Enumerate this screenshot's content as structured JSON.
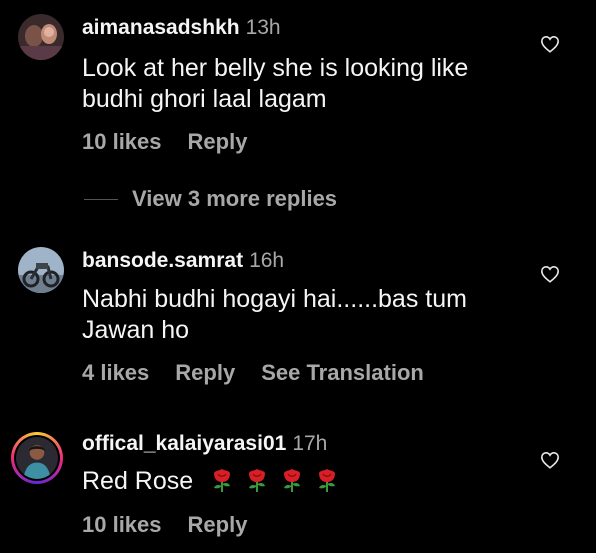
{
  "comments": [
    {
      "username": "aimanasadshkh",
      "time": "13h",
      "text": "Look at her belly she is looking like budhi ghori laal lagam",
      "likes": "10 likes",
      "reply": "Reply",
      "avatar_icon": "profile-photo"
    },
    {
      "username": "bansode.samrat",
      "time": "16h",
      "text": "Nabhi budhi hogayi hai......bas tum Jawan ho",
      "likes": "4 likes",
      "reply": "Reply",
      "translation": "See Translation",
      "avatar_icon": "motorcycle-photo"
    },
    {
      "username": "offical_kalaiyarasi01",
      "time": "17h",
      "text": "Red Rose",
      "emoji": [
        "rose-emoji",
        "rose-emoji",
        "rose-emoji",
        "rose-emoji"
      ],
      "likes": "10 likes",
      "reply": "Reply",
      "avatar_icon": "profile-photo-story-ring"
    }
  ],
  "view_replies": "View 3 more replies",
  "colors": {
    "background": "#000000",
    "primary_text": "#f5f5f5",
    "secondary_text": "#a8a8a8"
  }
}
